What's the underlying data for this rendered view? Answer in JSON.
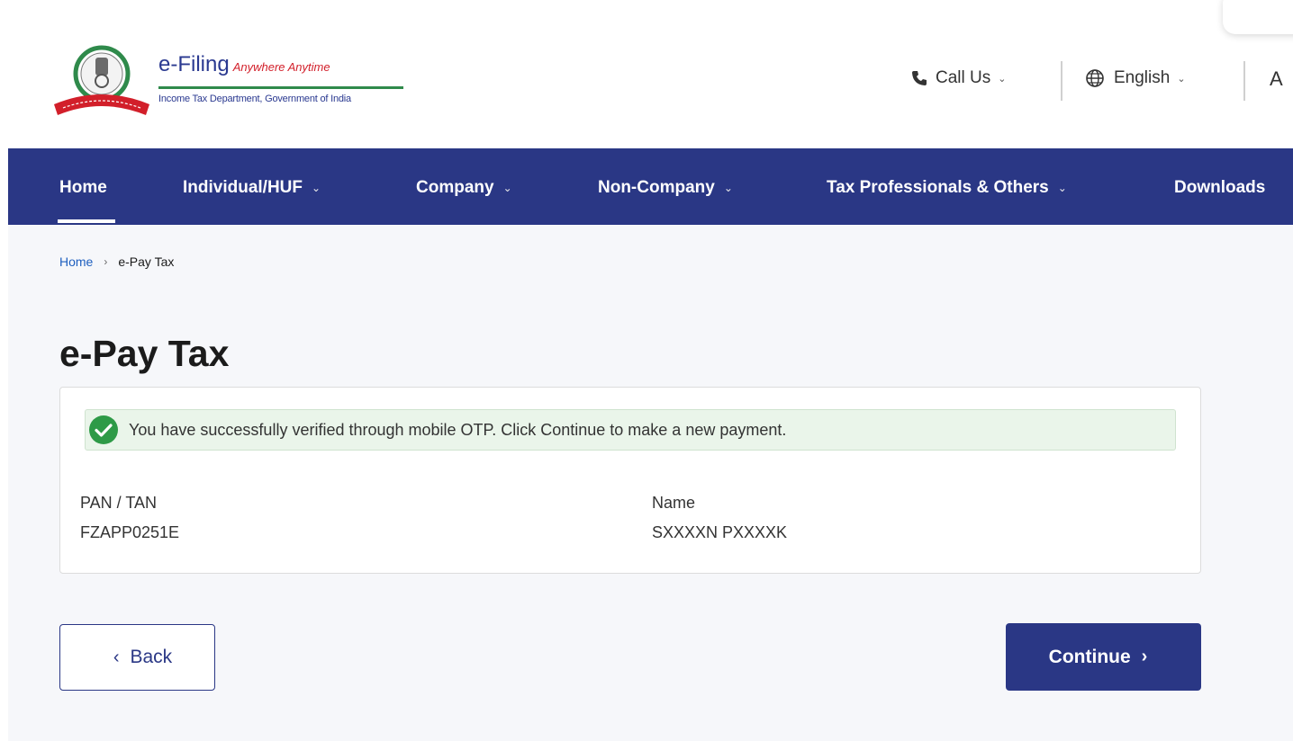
{
  "header": {
    "brand_title": "e-Filing",
    "brand_tagline": "Anywhere Anytime",
    "brand_subtitle": "Income Tax Department, Government of India",
    "call_us": "Call Us",
    "language": "English",
    "font_size_control": "A"
  },
  "nav": {
    "items": [
      {
        "label": "Home",
        "active": true
      },
      {
        "label": "Individual/HUF",
        "has_dropdown": true
      },
      {
        "label": "Company",
        "has_dropdown": true
      },
      {
        "label": "Non-Company",
        "has_dropdown": true
      },
      {
        "label": "Tax Professionals & Others",
        "has_dropdown": true
      },
      {
        "label": "Downloads"
      }
    ]
  },
  "breadcrumb": {
    "home": "Home",
    "current": "e-Pay Tax"
  },
  "page": {
    "title": "e-Pay Tax"
  },
  "alert": {
    "message": "You have successfully verified through mobile OTP. Click Continue to make a new payment."
  },
  "details": {
    "pan_label": "PAN / TAN",
    "pan_value": "FZAPP0251E",
    "name_label": "Name",
    "name_value": "SXXXXN PXXXXK"
  },
  "actions": {
    "back_label": "Back",
    "continue_label": "Continue"
  },
  "colors": {
    "primary": "#2a3785",
    "success": "#2e9a47",
    "link": "#1e5fbf"
  }
}
